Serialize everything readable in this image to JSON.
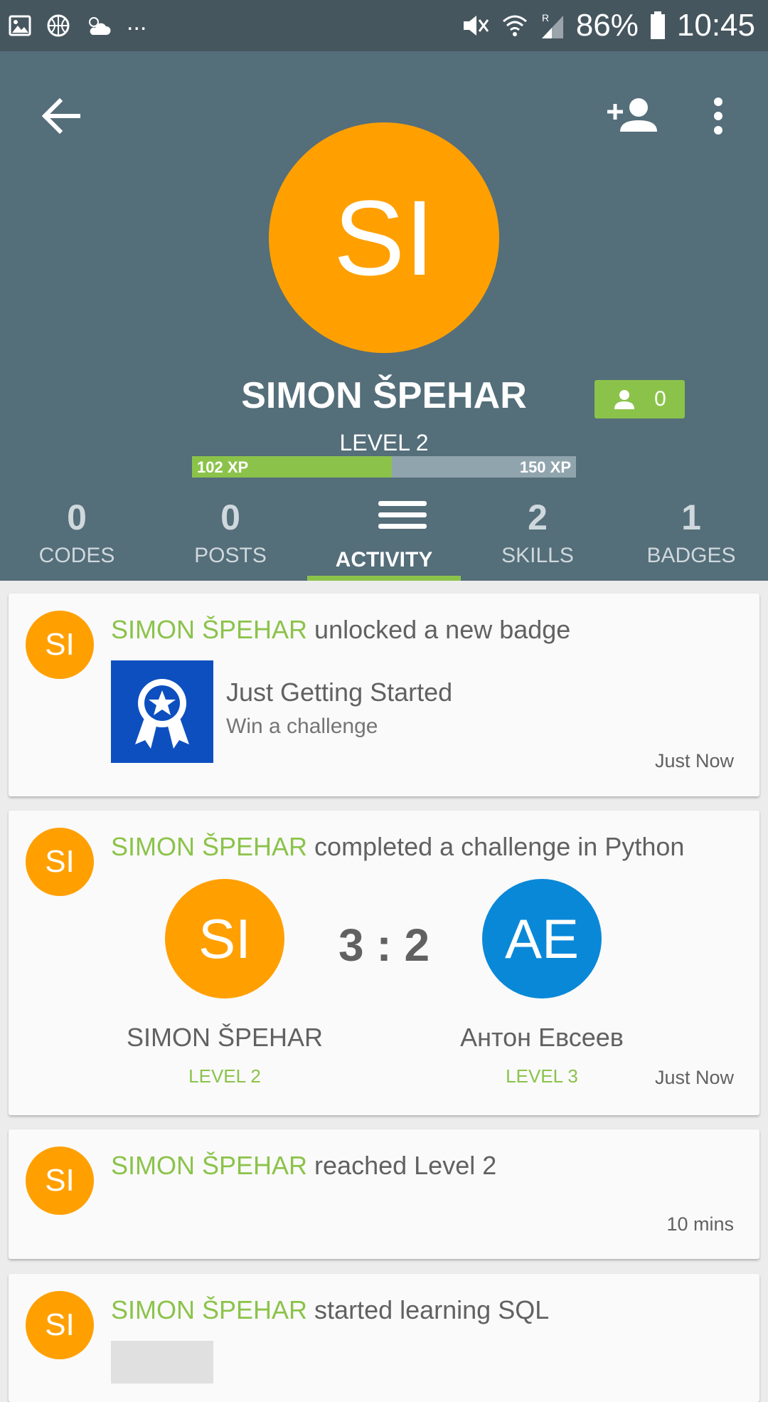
{
  "status_bar": {
    "more_dots": "...",
    "battery_percent": "86%",
    "time": "10:45"
  },
  "profile": {
    "initials": "SI",
    "name": "SIMON ŠPEHAR",
    "followers_count": "0",
    "level_label": "LEVEL 2",
    "xp_current": "102 XP",
    "xp_next": "150 XP",
    "xp_progress_fraction": 0.52
  },
  "tabs": [
    {
      "num": "0",
      "label": "CODES"
    },
    {
      "num": "0",
      "label": "POSTS"
    },
    {
      "label": "ACTIVITY"
    },
    {
      "num": "2",
      "label": "SKILLS"
    },
    {
      "num": "1",
      "label": "BADGES"
    }
  ],
  "feed": [
    {
      "avatar": "SI",
      "user": "SIMON ŠPEHAR",
      "action": " unlocked a new badge",
      "badge_title": "Just Getting Started",
      "badge_desc": "Win a challenge",
      "time": "Just Now"
    },
    {
      "avatar": "SI",
      "user": "SIMON ŠPEHAR",
      "action": " completed a challenge in Python",
      "score": "3 : 2",
      "player1": {
        "initials": "SI",
        "name": "SIMON ŠPEHAR",
        "level": "LEVEL 2",
        "color": "#ffa000"
      },
      "player2": {
        "initials": "AE",
        "name": "Антон Евсеев",
        "level": "LEVEL 3",
        "color": "#0a88d8"
      },
      "time": "Just Now"
    },
    {
      "avatar": "SI",
      "user": "SIMON ŠPEHAR",
      "action": " reached Level 2",
      "time": "10 mins"
    },
    {
      "avatar": "SI",
      "user": "SIMON ŠPEHAR",
      "action": " started learning SQL"
    }
  ],
  "colors": {
    "header": "#546e7a",
    "status_bar": "#46565f",
    "accent_green": "#8bc34a",
    "avatar_orange": "#ffa000",
    "badge_blue": "#0d4fbf"
  },
  "icons": [
    "image-icon",
    "basketball-icon",
    "weather-icon",
    "mute-icon",
    "wifi-icon",
    "signal-icon",
    "battery-icon",
    "back-arrow-icon",
    "add-person-icon",
    "more-vert-icon",
    "person-icon",
    "menu-icon",
    "badge-medal-icon"
  ]
}
